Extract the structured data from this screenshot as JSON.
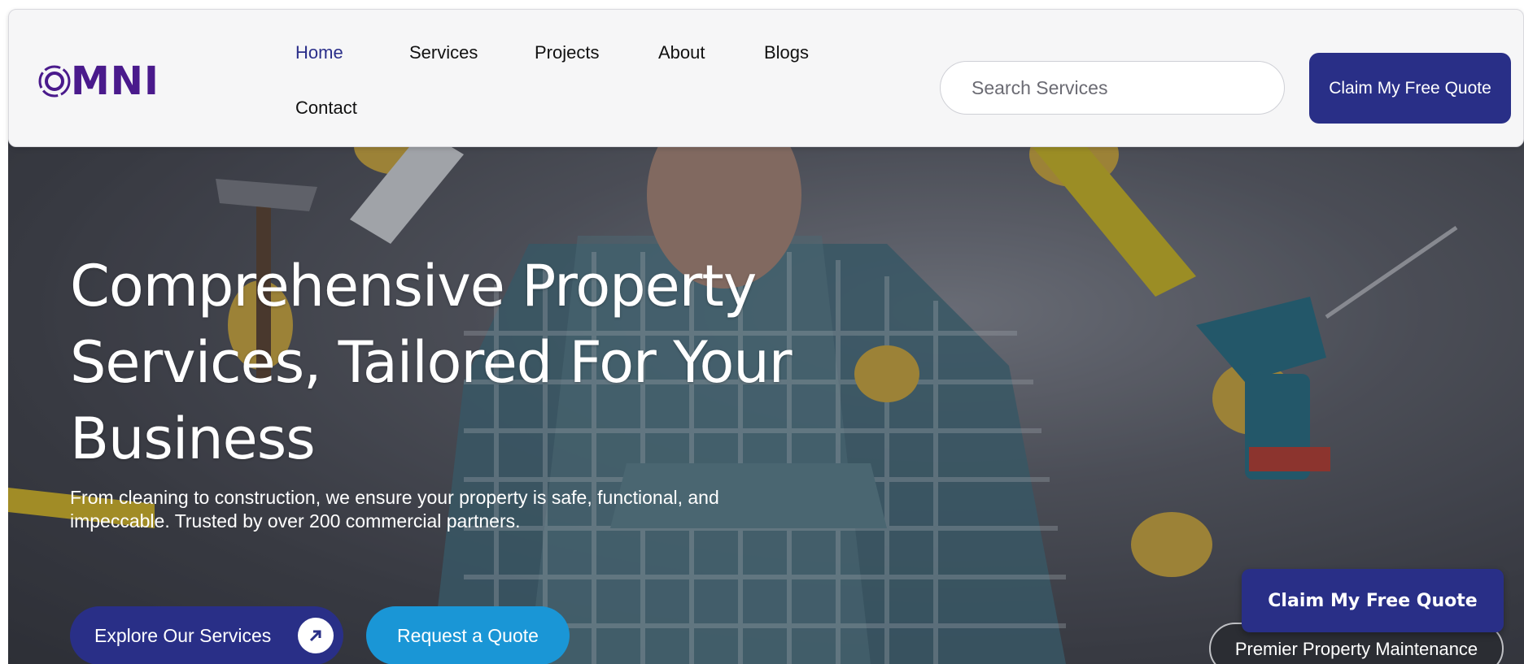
{
  "brand": {
    "logo_text": "MNI",
    "logo_letter": "O",
    "accent": "#292f87",
    "logo_color": "#4a1a8c"
  },
  "nav": {
    "items": [
      {
        "label": "Home",
        "active": true
      },
      {
        "label": "Services"
      },
      {
        "label": "Projects"
      },
      {
        "label": "About"
      },
      {
        "label": "Blogs"
      },
      {
        "label": "Contact"
      }
    ]
  },
  "search": {
    "placeholder": "Search Services",
    "value": ""
  },
  "header_cta": {
    "label": "Claim My Free Quote"
  },
  "hero": {
    "title": "Comprehensive Property Services, Tailored For Your Business",
    "subtitle": "From cleaning to construction, we ensure your property is safe, functional, and impeccable. Trusted by over 200 commercial partners.",
    "primary_button": "Explore Our Services",
    "primary_icon": "arrow-up-right-icon",
    "secondary_button": "Request a Quote",
    "secondary_color": "#1a96d6"
  },
  "floating": {
    "cta_label": "Claim My Free Quote",
    "badge_label": "Premier Property Maintenance"
  }
}
